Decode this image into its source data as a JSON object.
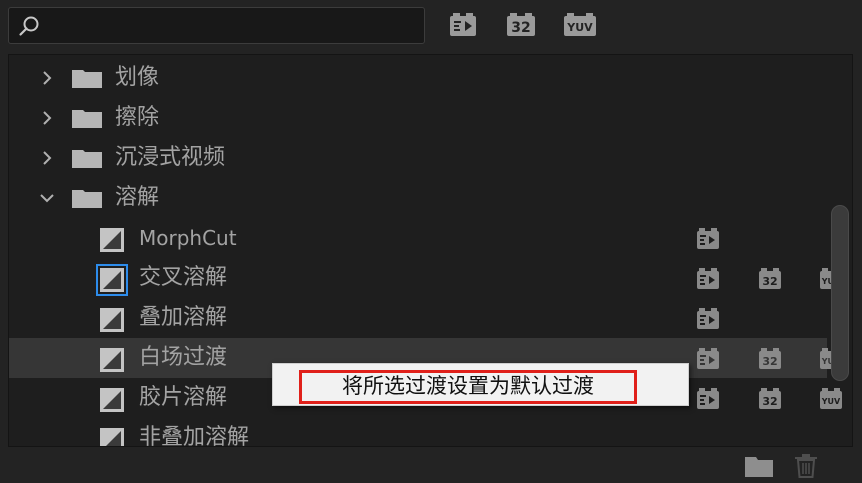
{
  "search": {
    "placeholder": "",
    "value": ""
  },
  "toolbar": {
    "filters": [
      {
        "name": "accelerated-effects-filter-icon",
        "label": ""
      },
      {
        "name": "32bit-filter-icon",
        "label": "32"
      },
      {
        "name": "yuv-filter-icon",
        "label": "YUV"
      }
    ]
  },
  "tree": {
    "folders": [
      {
        "label": "划像",
        "expanded": false
      },
      {
        "label": "擦除",
        "expanded": false
      },
      {
        "label": "沉浸式视频",
        "expanded": false
      },
      {
        "label": "溶解",
        "expanded": true
      }
    ],
    "effects": [
      {
        "label": "MorphCut",
        "badges": [
          "accelerated"
        ]
      },
      {
        "label": "交叉溶解",
        "badges": [
          "accelerated",
          "32",
          "YUV"
        ],
        "focused": true
      },
      {
        "label": "叠加溶解",
        "badges": [
          "accelerated"
        ]
      },
      {
        "label": "白场过渡",
        "badges": [
          "accelerated",
          "32",
          "YUV"
        ],
        "selected": true
      },
      {
        "label": "胶片溶解",
        "badges": [
          "accelerated",
          "32",
          "YUV"
        ]
      },
      {
        "label": "非叠加溶解",
        "badges": []
      }
    ]
  },
  "badge_labels": {
    "b32": "32",
    "yuv": "YUV"
  },
  "context_menu": {
    "item": "将所选过渡设置为默认过渡"
  },
  "colors": {
    "accent": "#2d8ceb",
    "highlight": "#e0201a",
    "selection": "#363636"
  }
}
